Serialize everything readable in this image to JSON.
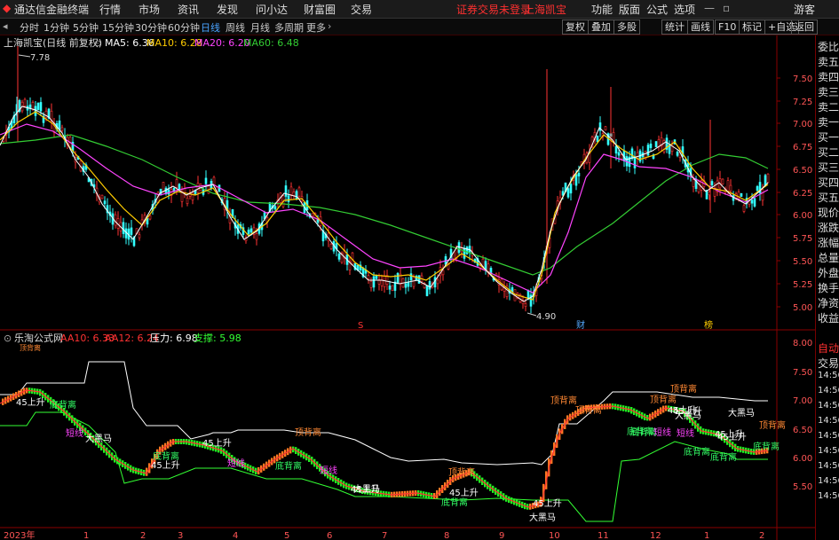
{
  "app": {
    "title": "通达信金融终端",
    "menu": [
      "行情",
      "市场",
      "资讯",
      "发现",
      "问小达",
      "财富圈",
      "交易"
    ],
    "alert": "证券交易未登录",
    "stock_name": "上海凯宝",
    "right_menu": [
      "功能",
      "版面",
      "公式",
      "选项"
    ],
    "user": "游客"
  },
  "periods": [
    "分时",
    "1分钟",
    "5分钟",
    "15分钟",
    "30分钟",
    "60分钟",
    "日线",
    "周线",
    "月线",
    "多周期",
    "更多"
  ],
  "active_period": "日线",
  "toolbar_right": [
    "复权",
    "叠加",
    "多股",
    "统计",
    "画线",
    "F10",
    "标记",
    "+自选",
    "返回"
  ],
  "main_chart": {
    "title": "上海凯宝(日线 前复权)",
    "ma_labels": [
      {
        "text": "MA5: 6.36",
        "color": "#ffffff"
      },
      {
        "text": "MA10: 6.28",
        "color": "#ffcc00"
      },
      {
        "text": "MA20: 6.20",
        "color": "#ff44ff"
      },
      {
        "text": "MA60: 6.48",
        "color": "#33cc33"
      }
    ],
    "high_label": "7.78",
    "low_label": "4.90",
    "y_ticks": [
      "7.50",
      "7.25",
      "7.00",
      "6.75",
      "6.50",
      "6.25",
      "6.00",
      "5.75",
      "5.50",
      "5.25",
      "5.00"
    ],
    "event_marks": [
      {
        "text": "S",
        "color": "#ff3333"
      },
      {
        "text": "财",
        "color": "#55aaff"
      },
      {
        "text": "榜",
        "color": "#ffcc00"
      }
    ]
  },
  "indicator": {
    "title": "乐淘公式网",
    "aa10": "AA10: 6.33",
    "aa12": "AA12: 6.24",
    "pressure": "压力: 6.98",
    "support": "支撑: 5.98",
    "top_note": "顶背离",
    "y_ticks": [
      "8.00",
      "7.50",
      "7.00",
      "6.50",
      "6.00",
      "5.50"
    ],
    "signals": [
      "45上升",
      "底背离",
      "短线",
      "大黑马",
      "45上升",
      "底背离",
      "短线",
      "45上升",
      "底背离",
      "顶背离",
      "短线",
      "45上升",
      "大黑马",
      "顶背离",
      "45上升",
      "底背离",
      "45上升",
      "顶背离",
      "顶背离",
      "底背离",
      "顶背离",
      "45上升",
      "大黑马",
      "短线",
      "底背离",
      "45上升",
      "大黑马",
      "底背离",
      "45上升",
      "顶背离",
      "底背离",
      "大黑马",
      "短线",
      "45上升",
      "底背离",
      "顶背离"
    ]
  },
  "x_axis": [
    "2023年",
    "1",
    "2",
    "3",
    "4",
    "5",
    "6",
    "7",
    "8",
    "9",
    "10",
    "11",
    "12",
    "1",
    "2"
  ],
  "right_panel": [
    "委比",
    "卖五",
    "卖四",
    "卖三",
    "卖二",
    "卖一",
    "买一",
    "买二",
    "买三",
    "买四",
    "买五",
    "现价",
    "涨跌",
    "涨幅",
    "总量",
    "外盘",
    "换手",
    "净资",
    "收益"
  ],
  "right_panel_lower": [
    "自动",
    "交易",
    "14:56",
    "14:56",
    "14:56",
    "14:56",
    "14:56",
    "14:56",
    "14:56",
    "14:56",
    "14:56"
  ],
  "colors": {
    "up": "#ff3333",
    "down": "#33ffff",
    "ma5": "#ffffff",
    "ma10": "#ffcc00",
    "ma20": "#ff44ff",
    "ma60": "#33cc33",
    "accent_red": "#ff3030"
  }
}
